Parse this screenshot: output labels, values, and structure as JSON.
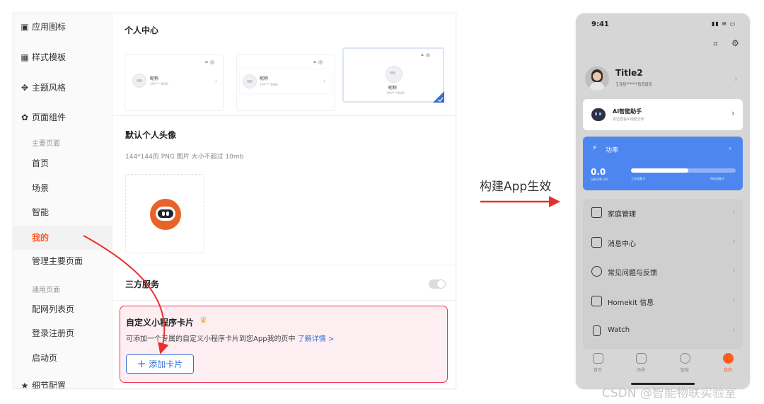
{
  "sidebar": {
    "app_icon": "应用图标",
    "style_template": "样式模板",
    "theme_style": "主题风格",
    "page_components": "页面组件",
    "main_pages_head": "主要页面",
    "main_pages": [
      "首页",
      "场景",
      "智能",
      "我的",
      "管理主要页面"
    ],
    "active_page": "我的",
    "common_pages_head": "通用页面",
    "common_pages": [
      "配网列表页",
      "登录注册页",
      "启动页"
    ],
    "detail_config": "细节配置"
  },
  "personal_center": {
    "title": "个人中心",
    "card_nickname": "昵称",
    "card_phone": "199****8888"
  },
  "default_avatar": {
    "title": "默认个人头像",
    "hint": "144*144的 PNG 图片 大小不超过 10mb"
  },
  "third_party": {
    "title": "三方服务",
    "enabled": false
  },
  "mini_program": {
    "title": "自定义小程序卡片",
    "desc": "可添加一个专属的自定义小程序卡片到您App我的页中",
    "learn_more": "了解详情 >",
    "add_button": "添加卡片"
  },
  "build_label": "构建App生效",
  "phone": {
    "time": "9:41",
    "user_name": "Title2",
    "user_phone": "199****8888",
    "ai_title": "AI智能助手",
    "ai_sub": "点击查看AI用能分析",
    "power_title": "功率",
    "power_value": "0.0",
    "power_unit": "当前功率 (W)",
    "working_devices": "工作设备 0",
    "standby_devices": "待机设备 0",
    "power_progress": 0.55,
    "menu": [
      "家庭管理",
      "消息中心",
      "常见问题与反馈",
      "Homekit 信息",
      "Watch"
    ],
    "tabs": [
      "首页",
      "场景",
      "智能",
      "我的"
    ],
    "active_tab": "我的"
  },
  "colors": {
    "accent_orange": "#ff5a1f",
    "accent_blue": "#2f6fd6",
    "arrow_red": "#e8312e",
    "power_card": "#4e86ef"
  },
  "watermark": "CSDN @智能物联实验室"
}
